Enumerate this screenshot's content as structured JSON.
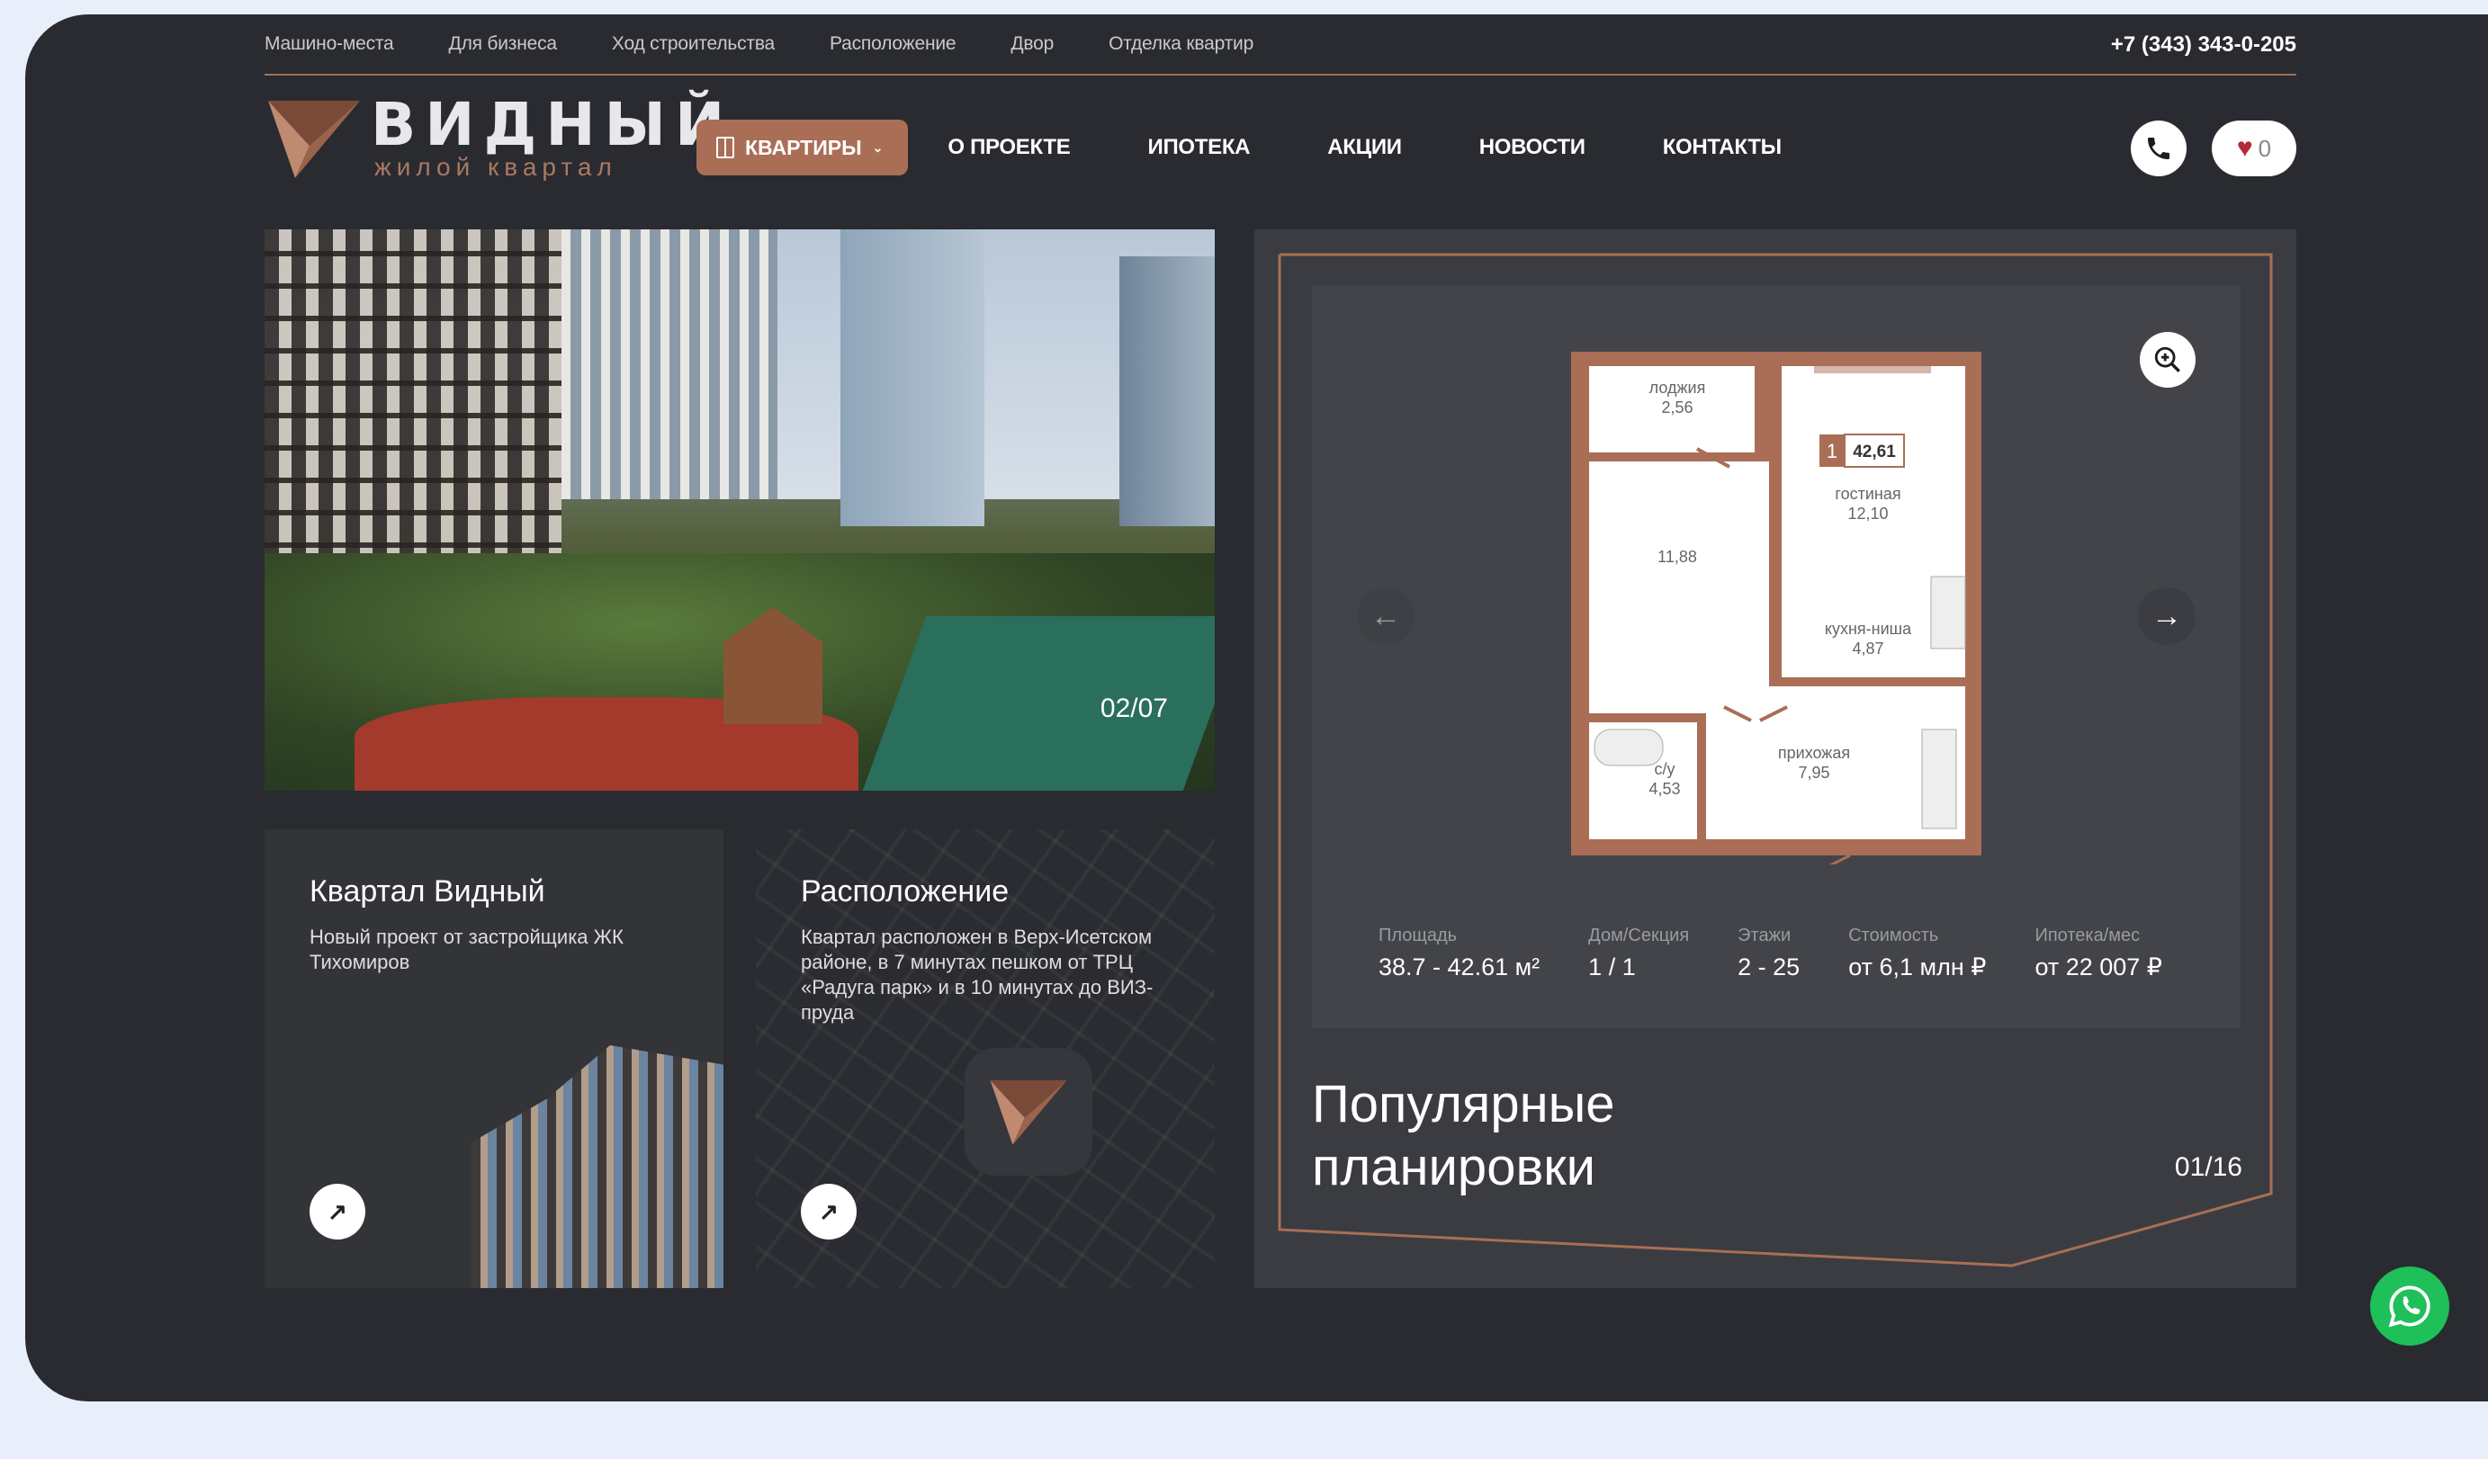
{
  "topbar": {
    "links": [
      "Машино-места",
      "Для бизнеса",
      "Ход строительства",
      "Расположение",
      "Двор",
      "Отделка квартир"
    ],
    "phone": "+7 (343) 343-0-205"
  },
  "logo": {
    "name": "ВИДНЫЙ",
    "subtitle": "жилой квартал"
  },
  "nav": {
    "apartments": "КВАРТИРЫ",
    "items": [
      "О ПРОЕКТЕ",
      "ИПОТЕКА",
      "АКЦИИ",
      "НОВОСТИ",
      "КОНТАКТЫ"
    ]
  },
  "favorites_count": "0",
  "hero": {
    "counter": "02/07"
  },
  "cards": [
    {
      "title": "Квартал Видный",
      "text": "Новый проект от застройщика ЖК Тихомиров"
    },
    {
      "title": "Расположение",
      "text": "Квартал расположен в Верх-Исетском районе, в 7 минутах пешком от ТРЦ «Радуга парк» и в 10 минутах до ВИЗ-пруда"
    }
  ],
  "plan": {
    "rooms": {
      "loggia": "лоджия",
      "loggia_area": "2,56",
      "bedroom_area": "11,88",
      "rooms_badge": "1",
      "total_area": "42,61",
      "living": "гостиная",
      "living_area": "12,10",
      "kitchen": "кухня-ниша",
      "kitchen_area": "4,87",
      "hall": "прихожая",
      "hall_area": "7,95",
      "bath": "с/у",
      "bath_area": "4,53"
    },
    "specs": [
      {
        "label": "Площадь",
        "value": "38.7 - 42.61 м²"
      },
      {
        "label": "Дом/Секция",
        "value": "1 / 1"
      },
      {
        "label": "Этажи",
        "value": "2 - 25"
      },
      {
        "label": "Стоимость",
        "value": "от 6,1 млн ₽"
      },
      {
        "label": "Ипотека/мес",
        "value": "от 22 007 ₽"
      }
    ],
    "title": "Популярные планировки",
    "counter": "01/16"
  },
  "colors": {
    "background": "#292b30",
    "accent": "#a96e55",
    "page": "#e9eefb",
    "whatsapp": "#1fbf5a"
  }
}
